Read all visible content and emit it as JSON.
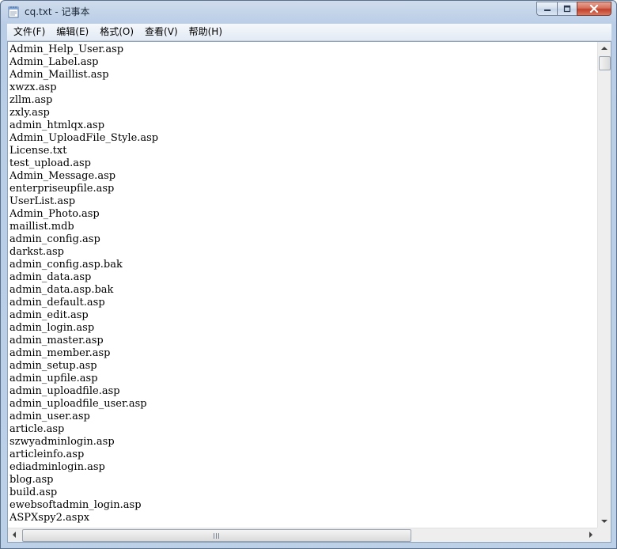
{
  "window": {
    "title": "cq.txt - 记事本"
  },
  "menu": [
    {
      "label": "文件(F)"
    },
    {
      "label": "编辑(E)"
    },
    {
      "label": "格式(O)"
    },
    {
      "label": "查看(V)"
    },
    {
      "label": "帮助(H)"
    }
  ],
  "document": {
    "lines": [
      "Admin_Help_User.asp",
      "Admin_Label.asp",
      "Admin_Maillist.asp",
      "xwzx.asp",
      "zllm.asp",
      "zxly.asp",
      "admin_htmlqx.asp",
      "Admin_UploadFile_Style.asp",
      "License.txt",
      "test_upload.asp",
      "Admin_Message.asp",
      "enterpriseupfile.asp",
      "UserList.asp",
      "Admin_Photo.asp",
      "maillist.mdb",
      "admin_config.asp",
      "darkst.asp",
      "admin_config.asp.bak",
      "admin_data.asp",
      "admin_data.asp.bak",
      "admin_default.asp",
      "admin_edit.asp",
      "admin_login.asp",
      "admin_master.asp",
      "admin_member.asp",
      "admin_setup.asp",
      "admin_upfile.asp",
      "admin_uploadfile.asp",
      "admin_uploadfile_user.asp",
      "admin_user.asp",
      "article.asp",
      "szwyadminlogin.asp",
      "articleinfo.asp",
      "ediadminlogin.asp",
      "blog.asp",
      "build.asp",
      "ewebsoftadmin_login.asp",
      "ASPXspy2.aspx"
    ]
  },
  "icons": {
    "app": "notepad-icon",
    "minimize": "minimize-icon",
    "maximize": "maximize-icon",
    "close": "close-icon"
  },
  "colors": {
    "titlebar": "#c4d5ea",
    "close_button": "#c2412b",
    "text": "#000000"
  }
}
